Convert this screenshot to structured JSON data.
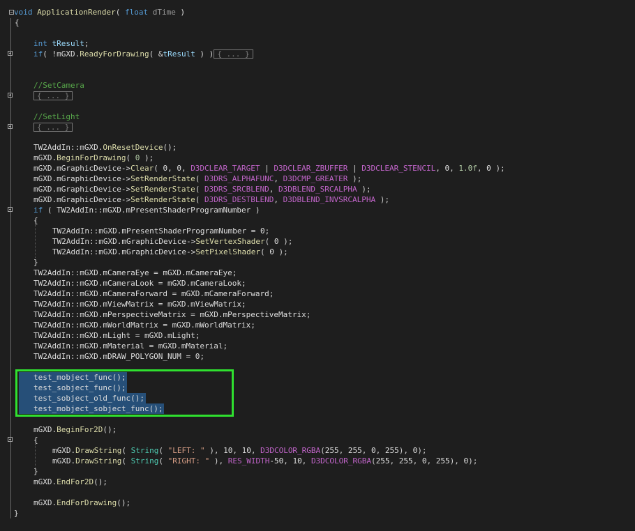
{
  "lines": {
    "l1": {
      "void": "void",
      "name": "ApplicationRender",
      "paren": "(",
      "type": "float",
      "param": "dTime",
      "close": ")"
    },
    "l2": {
      "text": "{"
    },
    "l4": {
      "type": "int",
      "var": "tResult",
      "semi": ";"
    },
    "l5": {
      "if": "if",
      "pre": "( !mGXD.",
      "fn": "ReadyForDrawing",
      "mid": "( &",
      "var": "tResult",
      "post": " ) )",
      "collapsed": "{ ... }"
    },
    "l8": {
      "comment": "//SetCamera"
    },
    "l9": {
      "collapsed": "{ ... }"
    },
    "l11": {
      "comment": "//SetLight"
    },
    "l12": {
      "collapsed": "{ ... }"
    },
    "l14": {
      "ns": "TW2AddIn::mGXD.",
      "fn": "OnResetDevice",
      "rest": "();"
    },
    "l15": {
      "obj": "mGXD.",
      "fn": "BeginForDrawing",
      "a": "( ",
      "n": "0",
      "b": " );"
    },
    "l16": {
      "obj": "mGXD.mGraphicDevice->",
      "fn": "Clear",
      "a": "( 0, 0, ",
      "m1": "D3DCLEAR_TARGET",
      "p1": " | ",
      "m2": "D3DCLEAR_ZBUFFER",
      "p2": " | ",
      "m3": "D3DCLEAR_STENCIL",
      "p3": ", 0, ",
      "f": "1.0f",
      "p4": ", 0 );"
    },
    "l17": {
      "obj": "mGXD.mGraphicDevice->",
      "fn": "SetRenderState",
      "a": "( ",
      "m1": "D3DRS_ALPHAFUNC",
      "p": ", ",
      "m2": "D3DCMP_GREATER",
      "b": " );"
    },
    "l18": {
      "obj": "mGXD.mGraphicDevice->",
      "fn": "SetRenderState",
      "a": "( ",
      "m1": "D3DRS_SRCBLEND",
      "p": ", ",
      "m2": "D3DBLEND_SRCALPHA",
      "b": " );"
    },
    "l19": {
      "obj": "mGXD.mGraphicDevice->",
      "fn": "SetRenderState",
      "a": "( ",
      "m1": "D3DRS_DESTBLEND",
      "p": ", ",
      "m2": "D3DBLEND_INVSRCALPHA",
      "b": " );"
    },
    "l20": {
      "if": "if",
      "rest": " ( TW2AddIn::mGXD.mPresentShaderProgramNumber )"
    },
    "l21": {
      "text": "{"
    },
    "l22": {
      "text": "TW2AddIn::mGXD.mPresentShaderProgramNumber = 0;"
    },
    "l23": {
      "obj": "TW2AddIn::mGXD.mGraphicDevice->",
      "fn": "SetVertexShader",
      "rest": "( 0 );"
    },
    "l24": {
      "obj": "TW2AddIn::mGXD.mGraphicDevice->",
      "fn": "SetPixelShader",
      "rest": "( 0 );"
    },
    "l25": {
      "text": "}"
    },
    "l26": {
      "text": "TW2AddIn::mGXD.mCameraEye = mGXD.mCameraEye;"
    },
    "l27": {
      "text": "TW2AddIn::mGXD.mCameraLook = mGXD.mCameraLook;"
    },
    "l28": {
      "text": "TW2AddIn::mGXD.mCameraForward = mGXD.mCameraForward;"
    },
    "l29": {
      "text": "TW2AddIn::mGXD.mViewMatrix = mGXD.mViewMatrix;"
    },
    "l30": {
      "text": "TW2AddIn::mGXD.mPerspectiveMatrix = mGXD.mPerspectiveMatrix;"
    },
    "l31": {
      "text": "TW2AddIn::mGXD.mWorldMatrix = mGXD.mWorldMatrix;"
    },
    "l32": {
      "text": "TW2AddIn::mGXD.mLight = mGXD.mLight;"
    },
    "l33": {
      "text": "TW2AddIn::mGXD.mMaterial = mGXD.mMaterial;"
    },
    "l34": {
      "text": "TW2AddIn::mGXD.mDRAW_POLYGON_NUM = 0;"
    },
    "l36": {
      "fn": "test_mobject_func",
      "rest": "();"
    },
    "l37": {
      "fn": "test_sobject_func",
      "rest": "();"
    },
    "l38": {
      "fn": "test_sobject_old_func",
      "rest": "();"
    },
    "l39": {
      "fn": "test_mobject_sobject_func",
      "rest": "();"
    },
    "l41": {
      "obj": "mGXD.",
      "fn": "BeginFor2D",
      "rest": "();"
    },
    "l42": {
      "text": "{"
    },
    "l43": {
      "obj": "mGXD.",
      "fn": "DrawString",
      "a": "( ",
      "ty": "String",
      "b": "( ",
      "s": "\"LEFT: \"",
      "c": " ), 10, 10, ",
      "mac": "D3DCOLOR_RGBA",
      "d": "(255, 255, 0, 255), 0);"
    },
    "l44": {
      "obj": "mGXD.",
      "fn": "DrawString",
      "a": "( ",
      "ty": "String",
      "b": "( ",
      "s": "\"RIGHT: \"",
      "c": " ), ",
      "mac1": "RES_WIDTH",
      "e": "-50, 10, ",
      "mac": "D3DCOLOR_RGBA",
      "d": "(255, 255, 0, 255), 0);"
    },
    "l45": {
      "text": "}"
    },
    "l46": {
      "obj": "mGXD.",
      "fn": "EndFor2D",
      "rest": "();"
    },
    "l48": {
      "obj": "mGXD.",
      "fn": "EndForDrawing",
      "rest": "();"
    },
    "l49": {
      "text": "}"
    }
  }
}
